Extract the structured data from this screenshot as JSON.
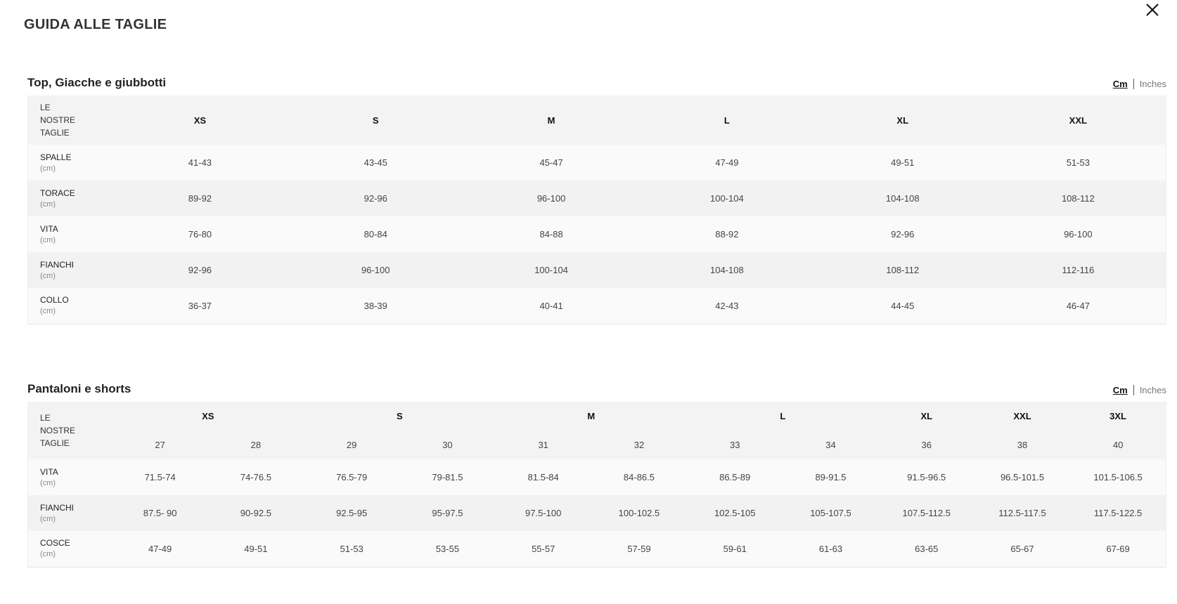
{
  "page": {
    "title": "GUIDA ALLE TAGLIE",
    "close_label": "×"
  },
  "tops": {
    "title": "Top, Giacche e giubbotti",
    "unit_cm": "Cm",
    "unit_inches": "Inches",
    "header_label": [
      "LE",
      "NOSTRE",
      "TAGLIE"
    ],
    "sizes": [
      "XS",
      "S",
      "M",
      "L",
      "XL",
      "XXL"
    ],
    "rows": [
      {
        "name": "SPALLE",
        "unit": "(cm)",
        "values": [
          "41-43",
          "43-45",
          "45-47",
          "47-49",
          "49-51",
          "51-53"
        ]
      },
      {
        "name": "TORACE",
        "unit": "(cm)",
        "values": [
          "89-92",
          "92-96",
          "96-100",
          "100-104",
          "104-108",
          "108-112"
        ]
      },
      {
        "name": "VITA",
        "unit": "(cm)",
        "values": [
          "76-80",
          "80-84",
          "84-88",
          "88-92",
          "92-96",
          "96-100"
        ]
      },
      {
        "name": "FIANCHI",
        "unit": "(cm)",
        "values": [
          "92-96",
          "96-100",
          "100-104",
          "104-108",
          "108-112",
          "112-116"
        ]
      },
      {
        "name": "COLLO",
        "unit": "(cm)",
        "values": [
          "36-37",
          "38-39",
          "40-41",
          "42-43",
          "44-45",
          "46-47"
        ]
      }
    ]
  },
  "pants": {
    "title": "Pantaloni e shorts",
    "unit_cm": "Cm",
    "unit_inches": "Inches",
    "header_label": [
      "LE",
      "NOSTRE",
      "TAGLIE"
    ],
    "size_groups": [
      {
        "label": "XS",
        "span": 2
      },
      {
        "label": "S",
        "span": 2
      },
      {
        "label": "M",
        "span": 2
      },
      {
        "label": "L",
        "span": 2
      },
      {
        "label": "XL",
        "span": 1
      },
      {
        "label": "XXL",
        "span": 1
      },
      {
        "label": "3XL",
        "span": 1
      }
    ],
    "waist_sizes": [
      "27",
      "28",
      "29",
      "30",
      "31",
      "32",
      "33",
      "34",
      "36",
      "38",
      "40"
    ],
    "rows": [
      {
        "name": "VITA",
        "unit": "(cm)",
        "values": [
          "71.5-74",
          "74-76.5",
          "76.5-79",
          "79-81.5",
          "81.5-84",
          "84-86.5",
          "86.5-89",
          "89-91.5",
          "91.5-96.5",
          "96.5-101.5",
          "101.5-106.5"
        ]
      },
      {
        "name": "FIANCHI",
        "unit": "(cm)",
        "values": [
          "87.5- 90",
          "90-92.5",
          "92.5-95",
          "95-97.5",
          "97.5-100",
          "100-102.5",
          "102.5-105",
          "105-107.5",
          "107.5-112.5",
          "112.5-117.5",
          "117.5-122.5"
        ]
      },
      {
        "name": "COSCE",
        "unit": "(cm)",
        "values": [
          "47-49",
          "49-51",
          "51-53",
          "53-55",
          "55-57",
          "57-59",
          "59-61",
          "61-63",
          "63-65",
          "65-67",
          "67-69"
        ]
      }
    ]
  }
}
